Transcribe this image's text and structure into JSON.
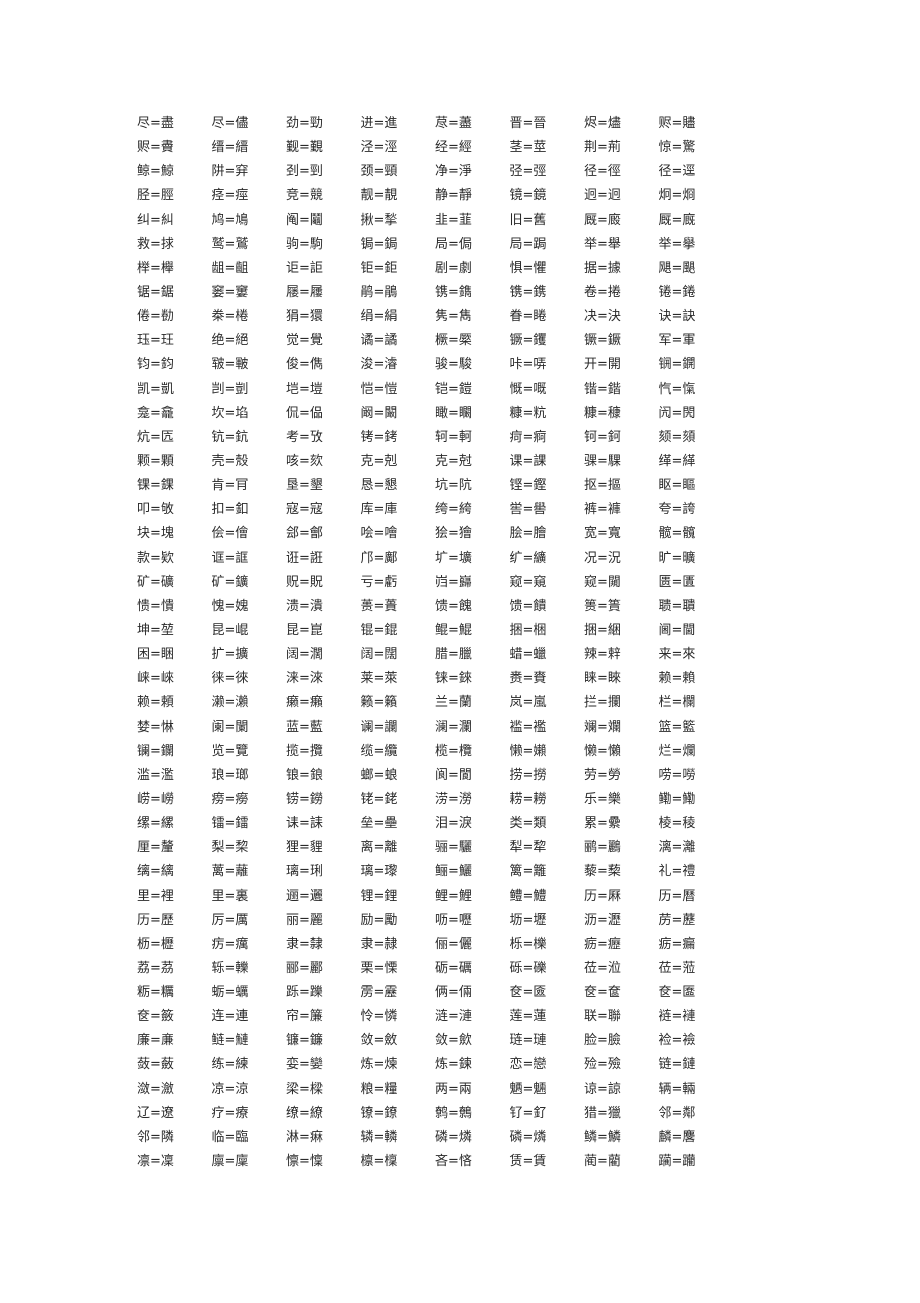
{
  "pairs": [
    "尽=盡",
    "尽=儘",
    "劲=勁",
    "进=進",
    "荩=藎",
    "晋=晉",
    "烬=燼",
    "赆=贐",
    "赆=賮",
    "缙=縉",
    "觐=覲",
    "泾=涇",
    "经=經",
    "茎=莖",
    "荆=荊",
    "惊=驚",
    "鲸=鯨",
    "阱=穽",
    "刭=剄",
    "颈=頸",
    "净=淨",
    "弪=弳",
    "径=徑",
    "径=逕",
    "胫=脛",
    "痉=痙",
    "竞=競",
    "靓=靚",
    "静=靜",
    "镜=鏡",
    "迥=迥",
    "炯=烱",
    "纠=糾",
    "鸠=鳩",
    "阄=鬮",
    "揪=揫",
    "韭=韮",
    "旧=舊",
    "厩=廄",
    "厩=廐",
    "救=捄",
    "鹫=鷲",
    "驹=駒",
    "锔=鋦",
    "局=侷",
    "局=跼",
    "举=舉",
    "举=擧",
    "榉=櫸",
    "龃=齟",
    "讵=詎",
    "钜=鉅",
    "剧=劇",
    "惧=懼",
    "据=據",
    "飓=颶",
    "锯=鋸",
    "窭=窶",
    "屦=屨",
    "鹃=鵑",
    "镌=鐫",
    "镌=鎸",
    "卷=捲",
    "锩=錈",
    "倦=勌",
    "桊=棬",
    "狷=獧",
    "绢=絹",
    "隽=雋",
    "眷=睠",
    "决=決",
    "诀=訣",
    "珏=玨",
    "绝=絕",
    "觉=覺",
    "谲=譎",
    "橛=橜",
    "镢=钁",
    "镢=鐝",
    "军=軍",
    "钧=鈞",
    "皲=皸",
    "俊=儁",
    "浚=濬",
    "骏=駿",
    "咔=哢",
    "开=開",
    "锎=鐦",
    "凯=凱",
    "剀=剴",
    "垲=塏",
    "恺=愷",
    "铠=鎧",
    "慨=嘅",
    "锴=鍇",
    "忾=愾",
    "龛=龕",
    "坎=埳",
    "侃=偘",
    "阚=闞",
    "瞰=矙",
    "糠=粇",
    "糠=穅",
    "闶=閌",
    "炕=匟",
    "钪=鈧",
    "考=攷",
    "铐=銬",
    "轲=軻",
    "疴=痾",
    "钶=鈳",
    "颏=頦",
    "颗=顆",
    "壳=殼",
    "咳=欬",
    "克=剋",
    "克=尅",
    "课=課",
    "骒=騍",
    "缂=緙",
    "锞=錁",
    "肯=肎",
    "垦=墾",
    "恳=懇",
    "坑=阬",
    "铿=鏗",
    "抠=摳",
    "眍=瞘",
    "叩=敂",
    "扣=釦",
    "寇=寇",
    "库=庫",
    "绔=絝",
    "喾=嚳",
    "裤=褲",
    "夸=誇",
    "块=塊",
    "侩=儈",
    "郐=鄶",
    "哙=噲",
    "狯=獪",
    "脍=膾",
    "宽=寬",
    "髋=髖",
    "款=欵",
    "诓=誆",
    "诳=誑",
    "邝=鄺",
    "圹=壙",
    "纩=纊",
    "况=況",
    "旷=曠",
    "矿=礦",
    "矿=鑛",
    "贶=貺",
    "亏=虧",
    "岿=巋",
    "窥=窺",
    "窥=闚",
    "匮=匱",
    "愦=憒",
    "愧=媿",
    "溃=潰",
    "蒉=蕢",
    "馈=餽",
    "馈=饋",
    "篑=簣",
    "聩=聵",
    "坤=堃",
    "昆=崐",
    "昆=崑",
    "锟=錕",
    "鲲=鯤",
    "捆=梱",
    "捆=綑",
    "阃=閫",
    "困=睏",
    "扩=擴",
    "阔=濶",
    "阔=闊",
    "腊=臘",
    "蜡=蠟",
    "辣=辢",
    "来=來",
    "崃=崍",
    "徕=徠",
    "涞=淶",
    "莱=萊",
    "铼=錸",
    "赉=賚",
    "睐=睞",
    "赖=賴",
    "赖=頼",
    "濑=瀨",
    "癞=癩",
    "籁=籟",
    "兰=蘭",
    "岚=嵐",
    "拦=攔",
    "栏=欄",
    "婪=惏",
    "阑=闌",
    "蓝=藍",
    "谰=讕",
    "澜=瀾",
    "褴=襤",
    "斓=斕",
    "篮=籃",
    "镧=鑭",
    "览=覽",
    "揽=攬",
    "缆=纜",
    "榄=欖",
    "懒=嬾",
    "懒=懶",
    "烂=爛",
    "滥=濫",
    "琅=瑯",
    "锒=鋃",
    "螂=蜋",
    "阆=閬",
    "捞=撈",
    "劳=勞",
    "唠=嘮",
    "崂=嶗",
    "痨=癆",
    "铹=鐒",
    "铑=銠",
    "涝=澇",
    "耢=耮",
    "乐=樂",
    "鳓=鰳",
    "缧=縲",
    "镭=鐳",
    "诔=誄",
    "垒=壘",
    "泪=淚",
    "类=類",
    "累=纍",
    "棱=稜",
    "厘=釐",
    "梨=棃",
    "狸=貍",
    "离=離",
    "骊=驪",
    "犁=犂",
    "鹂=鸝",
    "漓=灕",
    "缡=縭",
    "蓠=蘺",
    "璃=琍",
    "璃=瓈",
    "鲡=鱺",
    "篱=籬",
    "藜=蔾",
    "礼=禮",
    "里=裡",
    "里=裏",
    "逦=邐",
    "锂=鋰",
    "鲤=鯉",
    "鳢=鱧",
    "历=厤",
    "历=曆",
    "历=歷",
    "厉=厲",
    "丽=麗",
    "励=勵",
    "呖=嚦",
    "坜=壢",
    "沥=瀝",
    "苈=藶",
    "枥=櫪",
    "疠=癘",
    "隶=隸",
    "隶=隷",
    "俪=儷",
    "栎=櫟",
    "疬=癧",
    "疬=瘺",
    "荔=茘",
    "轹=轢",
    "郦=酈",
    "栗=慄",
    "砺=礪",
    "砾=礫",
    "莅=涖",
    "莅=蒞",
    "粝=糲",
    "蛎=蠣",
    "跞=躒",
    "雳=靂",
    "俩=倆",
    "奁=匳",
    "奁=奩",
    "奁=匲",
    "奁=籢",
    "连=連",
    "帘=簾",
    "怜=憐",
    "涟=漣",
    "莲=蓮",
    "联=聯",
    "裢=褳",
    "廉=亷",
    "鲢=鰱",
    "镰=鐮",
    "敛=斂",
    "敛=歛",
    "琏=璉",
    "脸=臉",
    "裣=襝",
    "蔹=蘞",
    "练=練",
    "娈=孌",
    "炼=煉",
    "炼=鍊",
    "恋=戀",
    "殓=殮",
    "链=鏈",
    "潋=瀲",
    "凉=涼",
    "梁=樑",
    "粮=糧",
    "两=兩",
    "魉=魎",
    "谅=諒",
    "辆=輛",
    "辽=遼",
    "疗=療",
    "缭=繚",
    "镣=鐐",
    "鹩=鷯",
    "钌=釕",
    "猎=獵",
    "邻=鄰",
    "邻=隣",
    "临=臨",
    "淋=痳",
    "辚=轔",
    "磷=燐",
    "磷=燐",
    "鳞=鱗",
    "麟=麐",
    "凛=凜",
    "廪=廩",
    "懔=懍",
    "檩=檁",
    "吝=悋",
    "赁=賃",
    "蔺=藺",
    "躏=躪"
  ]
}
